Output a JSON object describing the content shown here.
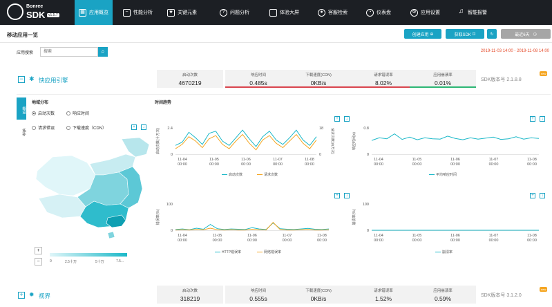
{
  "nav": {
    "brand": "Bonree",
    "sdk": "SDK",
    "version": "v1.5.7",
    "items": [
      {
        "label": "应用概览",
        "icon": "grid-icon"
      },
      {
        "label": "性能分析",
        "icon": "chart-icon"
      },
      {
        "label": "关键元素",
        "icon": "star-icon"
      },
      {
        "label": "问题分析",
        "icon": "question-icon"
      },
      {
        "label": "体验大屏",
        "icon": "monitor-icon"
      },
      {
        "label": "客服检索",
        "icon": "search-user-icon"
      },
      {
        "label": "仪表盘",
        "icon": "gauge-icon"
      },
      {
        "label": "应用设置",
        "icon": "gear-icon"
      },
      {
        "label": "智能报警",
        "icon": "bell-icon"
      }
    ]
  },
  "title_bar": {
    "title": "移动应用一览",
    "create_app": "创建应用",
    "get_sdk": "获取SDK",
    "recent": "最近6天"
  },
  "search": {
    "label": "应用搜索",
    "placeholder": "搜索",
    "date_range": "2019-11-03 14:00 - 2019-11-08 14:00"
  },
  "app1": {
    "name": "快应用引擎",
    "stats": [
      {
        "label": "启动次数",
        "value": "4670219",
        "bar_color": ""
      },
      {
        "label": "响应时间",
        "value": "0.485s",
        "bar_color": "#d9434c"
      },
      {
        "label": "下载速度(CDN)",
        "value": "0KB/s",
        "bar_color": "#d9434c"
      },
      {
        "label": "请求错误率",
        "value": "8.02%",
        "bar_color": "#d9434c"
      },
      {
        "label": "应用崩溃率",
        "value": "0.01%",
        "bar_color": "#2bb673"
      }
    ],
    "sdk_version": "SDK版本号 2.1.8.8",
    "new_badge": "new"
  },
  "app2": {
    "name": "视界",
    "stats": [
      {
        "label": "启动次数",
        "value": "318219"
      },
      {
        "label": "响应时间",
        "value": "0.555s"
      },
      {
        "label": "下载速度(CDN)",
        "value": "0KB/s"
      },
      {
        "label": "请求错误率",
        "value": "1.52%"
      },
      {
        "label": "应用崩溃率",
        "value": "0.59%"
      }
    ],
    "sdk_version": "SDK版本号 3.1.2.0",
    "new_badge": "new"
  },
  "panel": {
    "tabs": [
      "概览",
      "拓扑"
    ],
    "region_title": "地域分布",
    "radios": [
      "启动次数",
      "响应时间",
      "请求错误",
      "下载速度（CDN）"
    ],
    "map_legend_ticks": [
      "0",
      "2.5十万",
      "5十万",
      "7.5..."
    ],
    "map_colors": {
      "low": "#e0f6f9",
      "high": "#1ab8c8"
    },
    "trend_title": "时间趋势"
  },
  "chart_data": [
    {
      "type": "line",
      "x": [
        "11-04 00:00",
        "11-05 00:00",
        "11-06 00:00",
        "11-07 00:00",
        "11-08 00:00"
      ],
      "ylabel": "启动次数(十万次)",
      "y2label": "请求次数(百万次)",
      "ylim": [
        0,
        2.4
      ],
      "y2lim": [
        0,
        18
      ],
      "yticks": [
        "0",
        "2.4"
      ],
      "y2ticks": [
        "0",
        "18"
      ],
      "series": [
        {
          "name": "启动次数",
          "color": "#1ab8c8",
          "values": [
            0.8,
            1.1,
            2.0,
            1.5,
            0.9,
            1.9,
            2.1,
            1.2,
            0.8,
            1.5,
            2.2,
            1.4,
            0.7,
            1.6,
            2.1,
            1.3,
            0.9,
            1.5,
            2.2,
            1.3,
            0.8,
            1.6
          ]
        },
        {
          "name": "请求次数",
          "color": "#f5a623",
          "values": [
            0.5,
            0.9,
            1.6,
            1.2,
            0.6,
            1.4,
            1.7,
            0.9,
            0.5,
            1.2,
            1.8,
            1.0,
            0.4,
            1.3,
            1.7,
            1.0,
            0.6,
            1.2,
            1.8,
            1.0,
            0.5,
            1.3
          ]
        }
      ]
    },
    {
      "type": "line",
      "x": [
        "11-04 00:00",
        "11-05 00:00",
        "11-06 00:00",
        "11-07 00:00",
        "11-08 00:00"
      ],
      "ylabel": "响应时间(s)",
      "ylim": [
        0,
        0.8
      ],
      "yticks": [
        "0",
        "0.8"
      ],
      "series": [
        {
          "name": "平均响应时间",
          "color": "#1ab8c8",
          "values": [
            0.42,
            0.5,
            0.47,
            0.62,
            0.45,
            0.52,
            0.44,
            0.5,
            0.47,
            0.46,
            0.55,
            0.48,
            0.44,
            0.5,
            0.46,
            0.49,
            0.52,
            0.45,
            0.47,
            0.53,
            0.46,
            0.5,
            0.48
          ]
        }
      ]
    },
    {
      "type": "line",
      "x": [
        "11-04 00:00",
        "11-05 00:00",
        "11-06 00:00",
        "11-07 00:00",
        "11-08 00:00"
      ],
      "ylabel": "错误率(%)",
      "ylim": [
        0,
        100
      ],
      "yticks": [
        "0",
        "100"
      ],
      "series": [
        {
          "name": "HTTP错误率",
          "color": "#1ab8c8",
          "values": [
            3,
            5,
            2,
            8,
            4,
            22,
            6,
            3,
            5,
            4,
            3,
            10,
            5,
            3,
            28,
            6,
            4,
            3,
            5,
            7,
            4,
            3,
            5
          ]
        },
        {
          "name": "网络错误率",
          "color": "#f5a623",
          "values": [
            1,
            2,
            1,
            3,
            2,
            8,
            2,
            1,
            2,
            1,
            1,
            4,
            2,
            1,
            30,
            3,
            1,
            1,
            2,
            3,
            1,
            1,
            2
          ]
        }
      ]
    },
    {
      "type": "line",
      "x": [
        "11-04 00:00",
        "11-05 00:00",
        "11-06 00:00",
        "11-07 00:00",
        "11-08 00:00"
      ],
      "ylabel": "崩溃率(%)",
      "ylim": [
        0,
        100
      ],
      "yticks": [
        "0",
        "100"
      ],
      "series": [
        {
          "name": "崩溃率",
          "color": "#1ab8c8",
          "values": [
            0.1,
            0.1,
            0.1,
            0.1,
            0.1,
            0.1,
            0.1,
            0.1,
            0.1,
            0.1,
            0.1
          ]
        }
      ]
    }
  ]
}
